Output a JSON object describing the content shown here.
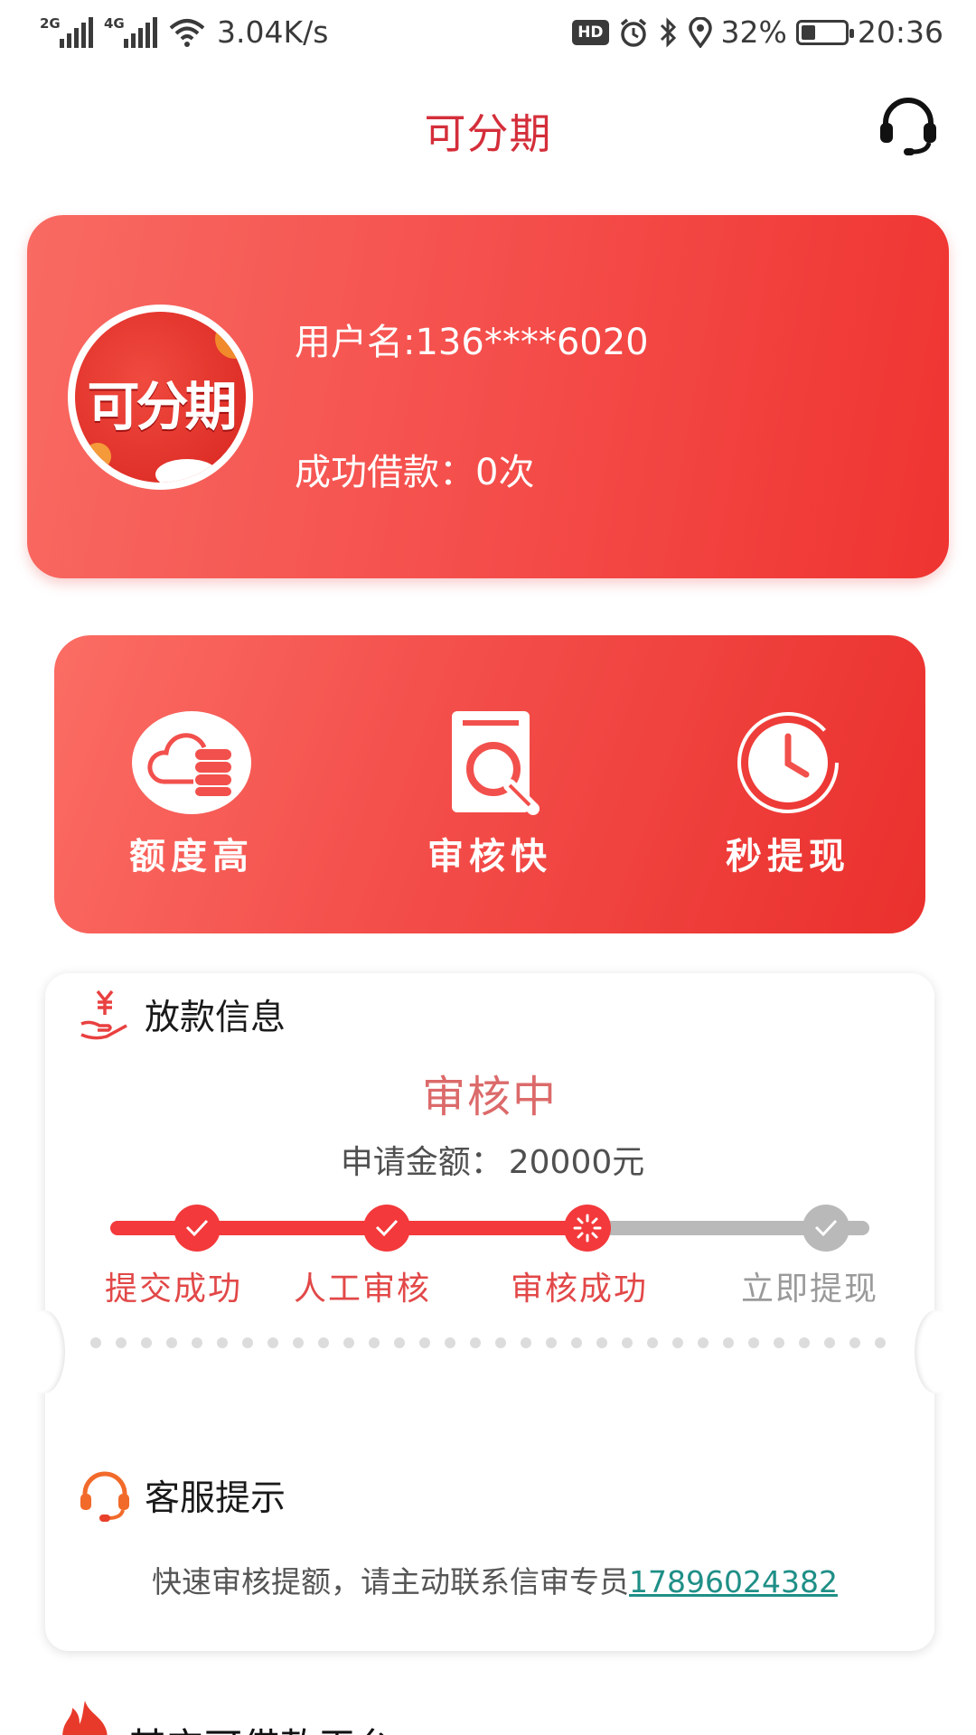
{
  "status_bar": {
    "sim1_label": "2G",
    "sim2_label": "4G",
    "net_speed": "3.04K/s",
    "hd_label": "HD",
    "battery_percent": "32%",
    "battery_level": 0.32,
    "time": "20:36"
  },
  "header": {
    "title": "可分期",
    "support_icon": "headset-icon"
  },
  "profile": {
    "avatar_brand": "可分期",
    "username": "用户名:136****6020",
    "successful_loans": "成功借款：0次"
  },
  "features": [
    {
      "label": "额度高",
      "icon": "cloud-coins-icon"
    },
    {
      "label": "审核快",
      "icon": "document-search-icon"
    },
    {
      "label": "秒提现",
      "icon": "clock-icon"
    }
  ],
  "loan_info": {
    "section_title": "放款信息",
    "section_icon": "yen-hand-icon",
    "status": "审核中",
    "amount_label": "申请金额：",
    "amount_value": "20000元",
    "steps": [
      {
        "label": "提交成功",
        "state": "done"
      },
      {
        "label": "人工审核",
        "state": "done"
      },
      {
        "label": "审核成功",
        "state": "active"
      },
      {
        "label": "立即提现",
        "state": "pending"
      }
    ],
    "colors": {
      "active": "#f3393b",
      "pending": "#b9b9b9",
      "label_active": "#e24848",
      "label_pending": "#9a9a9a"
    }
  },
  "support_tip": {
    "title": "客服提示",
    "icon": "headset-orange-icon",
    "message": "快速审核提额，请主动联系信审专员",
    "phone": "17896024382"
  },
  "other_platforms": {
    "title": "其它可借款平台",
    "icon": "flame-icon"
  }
}
